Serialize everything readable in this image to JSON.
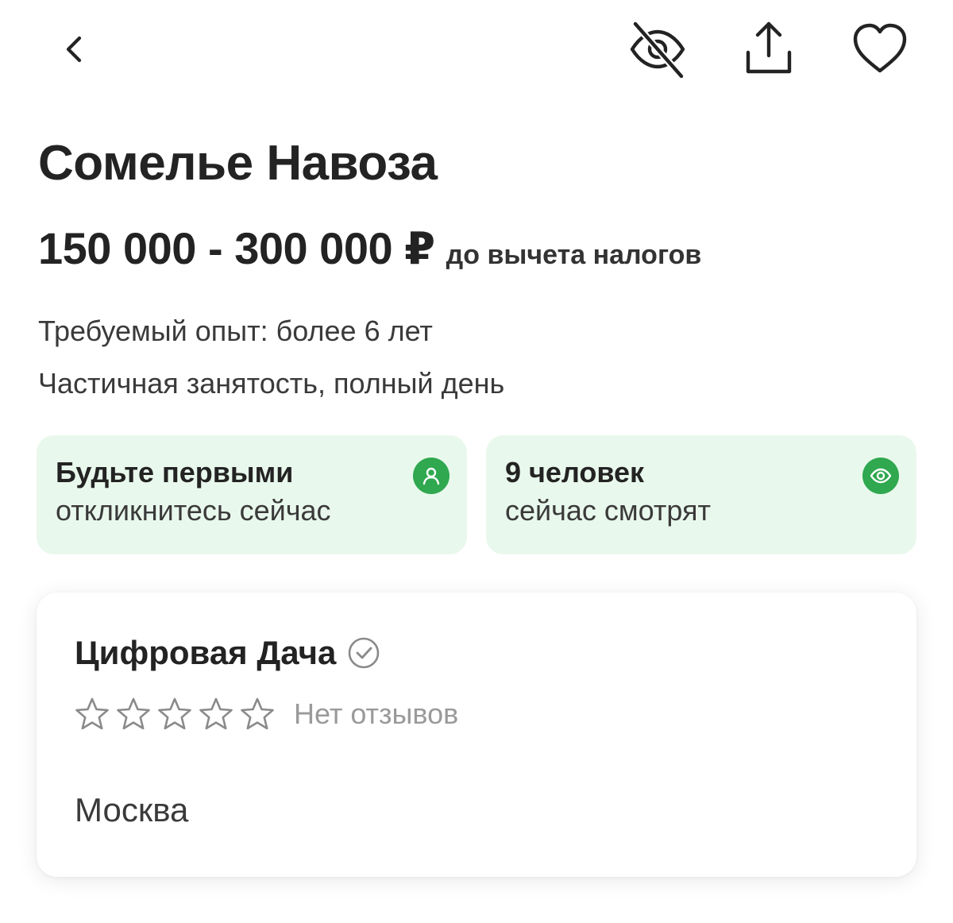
{
  "header": {
    "back_icon": "chevron-left-icon",
    "hide_icon": "eye-off-icon",
    "share_icon": "share-upload-icon",
    "favorite_icon": "heart-icon"
  },
  "vacancy": {
    "title": "Сомелье Навоза",
    "salary": "150 000 - 300 000 ₽",
    "salary_note": "до вычета налогов",
    "experience": "Требуемый опыт: более 6 лет",
    "employment": "Частичная занятость, полный день"
  },
  "info_cards": [
    {
      "title": "Будьте первыми",
      "subtitle": "откликнитесь сейчас",
      "icon": "person-icon"
    },
    {
      "title": "9 человек",
      "subtitle": "сейчас смотрят",
      "icon": "eye-icon"
    }
  ],
  "company": {
    "name": "Цифровая Дача",
    "verified_icon": "verified-check-icon",
    "rating": 0,
    "rating_max": 5,
    "reviews_text": "Нет отзывов",
    "city": "Москва"
  },
  "colors": {
    "accent_green": "#2fa84f",
    "card_green_bg": "#e9f8ec",
    "text_primary": "#232323",
    "text_muted": "#9a9a9a"
  }
}
